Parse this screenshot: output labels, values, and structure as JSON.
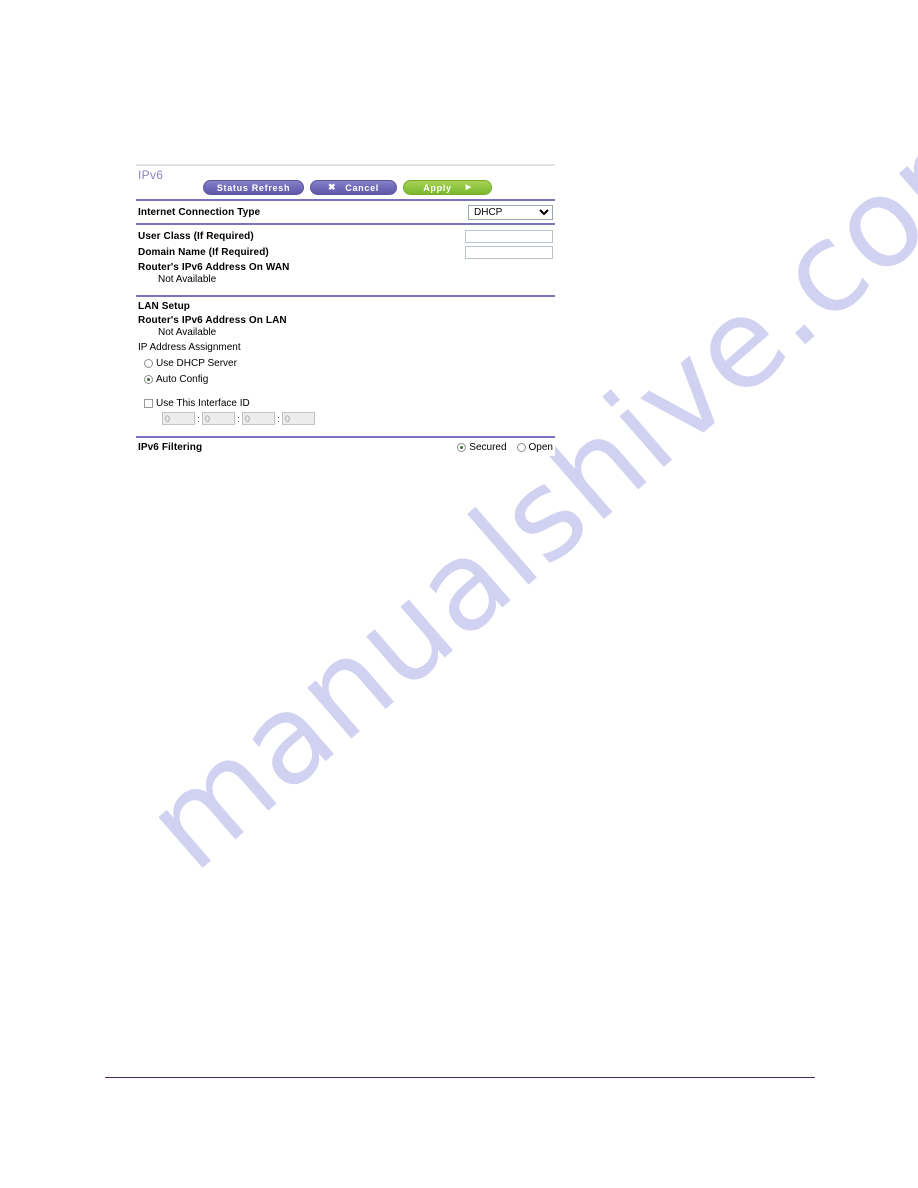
{
  "page": {
    "watermark": "manualshive.com",
    "accent_purple": "#6f68b8",
    "accent_green": "#8cc63e",
    "title_color": "#8a86c4"
  },
  "panel": {
    "title": "IPv6",
    "buttons": {
      "status_refresh": "Status Refresh",
      "cancel": "Cancel",
      "cancel_glyph": "✖",
      "apply": "Apply",
      "apply_glyph": "▶"
    },
    "internet_connection": {
      "label": "Internet Connection Type",
      "selected": "DHCP",
      "options": [
        "DHCP"
      ]
    },
    "user_class": {
      "label": "User Class  (If Required)",
      "value": "",
      "placeholder": ""
    },
    "domain_name": {
      "label": "Domain Name  (If Required)",
      "value": "",
      "placeholder": ""
    },
    "wan_address": {
      "label": "Router's IPv6 Address On WAN",
      "value": "Not Available"
    },
    "lan_setup": {
      "heading": "LAN Setup",
      "lan_address": {
        "label": "Router's IPv6 Address On LAN",
        "value": "Not Available"
      },
      "ip_assignment": {
        "label": "IP Address Assignment",
        "options": [
          {
            "label": "Use DHCP Server",
            "selected": false
          },
          {
            "label": "Auto Config",
            "selected": true
          }
        ]
      },
      "interface_id": {
        "label": "Use This Interface ID",
        "checked": false,
        "separator": ":",
        "fields": [
          "0",
          "0",
          "0",
          "0"
        ]
      }
    },
    "ipv6_filtering": {
      "label": "IPv6 Filtering",
      "options": [
        {
          "label": "Secured",
          "selected": true
        },
        {
          "label": "Open",
          "selected": false
        }
      ]
    }
  }
}
